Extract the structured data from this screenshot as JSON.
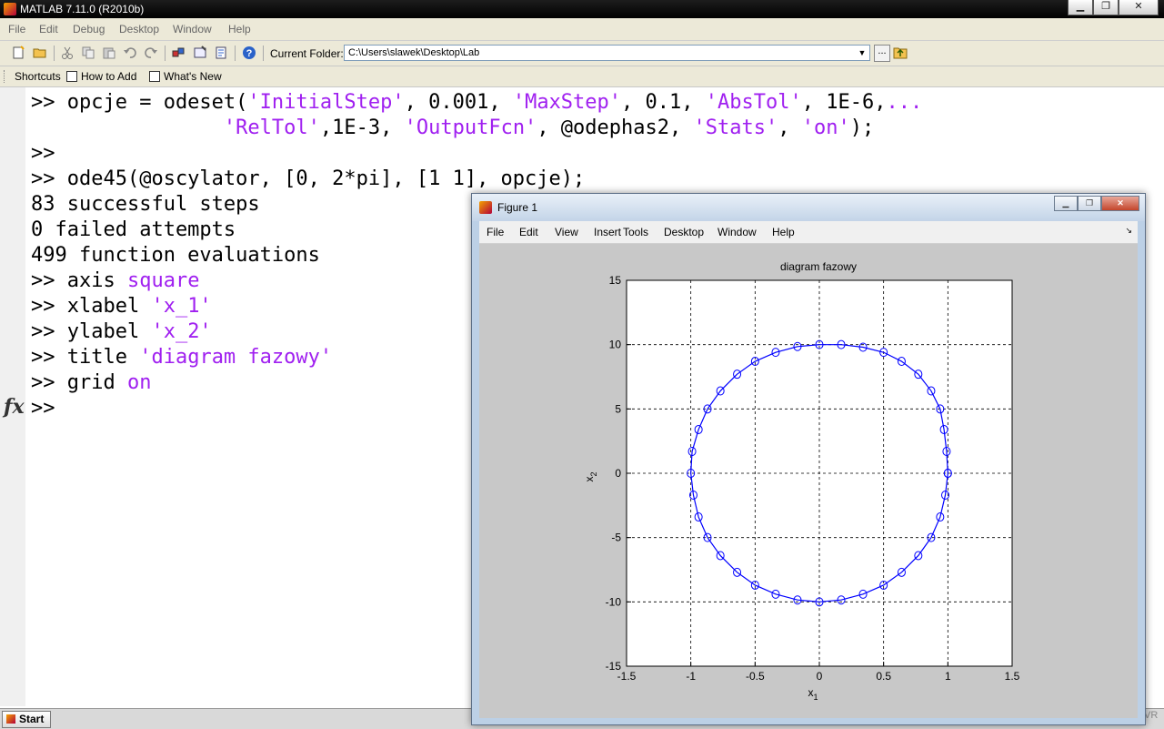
{
  "window": {
    "title": "MATLAB  7.11.0 (R2010b)",
    "buttons": [
      "▁",
      "❐",
      "✕"
    ]
  },
  "menu": [
    "File",
    "Edit",
    "Debug",
    "Desktop",
    "Window",
    "Help"
  ],
  "toolbar": {
    "current_folder_label": "Current Folder:",
    "current_folder_value": "C:\\Users\\slawek\\Desktop\\Lab",
    "browse_label": "..."
  },
  "shortcuts": [
    "Shortcuts",
    "How to Add",
    "What's New"
  ],
  "command_window": {
    "lines": [
      {
        "parts": [
          {
            "t": ">> opcje = odeset("
          },
          {
            "t": "'InitialStep'",
            "s": 1
          },
          {
            "t": ", 0.001, "
          },
          {
            "t": "'MaxStep'",
            "s": 1
          },
          {
            "t": ", 0.1, "
          },
          {
            "t": "'AbsTol'",
            "s": 1
          },
          {
            "t": ", 1E-6,"
          },
          {
            "t": "...",
            "s": 1
          }
        ]
      },
      {
        "parts": [
          {
            "t": "                "
          },
          {
            "t": "'RelTol'",
            "s": 1
          },
          {
            "t": ",1E-3, "
          },
          {
            "t": "'OutputFcn'",
            "s": 1
          },
          {
            "t": ", @odephas2, "
          },
          {
            "t": "'Stats'",
            "s": 1
          },
          {
            "t": ", "
          },
          {
            "t": "'on'",
            "s": 1
          },
          {
            "t": ");"
          }
        ]
      },
      {
        "parts": [
          {
            "t": ">>"
          }
        ]
      },
      {
        "parts": [
          {
            "t": ">> ode45(@oscylator, [0, 2*pi], [1 1], opcje);"
          }
        ]
      },
      {
        "parts": [
          {
            "t": "83 successful steps"
          }
        ]
      },
      {
        "parts": [
          {
            "t": "0 failed attempts"
          }
        ]
      },
      {
        "parts": [
          {
            "t": "499 function evaluations"
          }
        ]
      },
      {
        "parts": [
          {
            "t": ">> axis "
          },
          {
            "t": "square",
            "s": 1
          }
        ]
      },
      {
        "parts": [
          {
            "t": ">> xlabel "
          },
          {
            "t": "'x_1'",
            "s": 1
          }
        ]
      },
      {
        "parts": [
          {
            "t": ">> ylabel "
          },
          {
            "t": "'x_2'",
            "s": 1
          }
        ]
      },
      {
        "parts": [
          {
            "t": ">> title "
          },
          {
            "t": "'diagram fazowy'",
            "s": 1
          }
        ]
      },
      {
        "parts": [
          {
            "t": ">> grid "
          },
          {
            "t": "on",
            "s": 1
          }
        ]
      },
      {
        "parts": [
          {
            "t": ">>"
          }
        ]
      }
    ],
    "fx_label": "fx"
  },
  "taskbar": {
    "start_label": "Start",
    "tray_text": "VR"
  },
  "figure": {
    "title": "Figure 1",
    "buttons": [
      "▁",
      "❐",
      "✕"
    ],
    "menu": [
      "File",
      "Edit",
      "View",
      "Insert",
      "Tools",
      "Desktop",
      "Window",
      "Help"
    ],
    "menu_arrow": "↘"
  },
  "chart_data": {
    "type": "line",
    "title": "diagram fazowy",
    "xlabel": "x",
    "xlabel_sub": "1",
    "ylabel": "x",
    "ylabel_sub": "2",
    "xlim": [
      -1.5,
      1.5
    ],
    "ylim": [
      -15,
      15
    ],
    "xticks": [
      "-1.5",
      "-1",
      "-0.5",
      "0",
      "0.5",
      "1",
      "1.5"
    ],
    "yticks": [
      "15",
      "10",
      "5",
      "0",
      "-5",
      "-10",
      "-15"
    ],
    "grid": true,
    "series": [
      {
        "marker": "circle",
        "color": "#0000ff",
        "x": [
          1,
          0.99,
          0.97,
          0.94,
          0.87,
          0.77,
          0.64,
          0.5,
          0.34,
          0.17,
          0,
          -0.17,
          -0.34,
          -0.5,
          -0.64,
          -0.77,
          -0.87,
          -0.94,
          -0.99,
          -1,
          -0.98,
          -0.94,
          -0.87,
          -0.77,
          -0.64,
          -0.5,
          -0.34,
          -0.17,
          0,
          0.17,
          0.34,
          0.5,
          0.64,
          0.77,
          0.87,
          0.94,
          0.98,
          1
        ],
        "y": [
          0,
          1.7,
          3.4,
          5,
          6.4,
          7.7,
          8.7,
          9.4,
          9.8,
          10,
          10,
          9.85,
          9.4,
          8.7,
          7.7,
          6.4,
          5,
          3.4,
          1.7,
          0,
          -1.7,
          -3.4,
          -5,
          -6.4,
          -7.7,
          -8.7,
          -9.4,
          -9.85,
          -10,
          -9.85,
          -9.4,
          -8.7,
          -7.7,
          -6.4,
          -5,
          -3.4,
          -1.7,
          0
        ]
      }
    ]
  },
  "colors": {
    "string": "#a020f0",
    "plot_line": "#0000ff",
    "plot_highlight": "#00aa66"
  }
}
